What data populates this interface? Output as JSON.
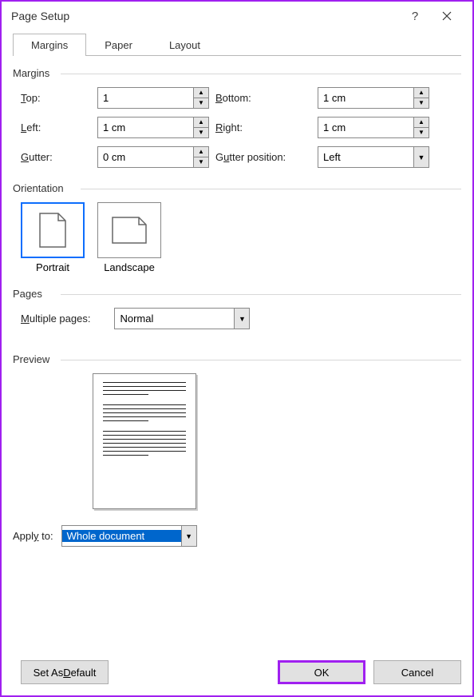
{
  "title": "Page Setup",
  "tabs": {
    "margins": "Margins",
    "paper": "Paper",
    "layout": "Layout"
  },
  "groups": {
    "margins": "Margins",
    "orientation": "Orientation",
    "pages": "Pages",
    "preview": "Preview"
  },
  "margin_fields": {
    "top_label": "Top:",
    "top_value": "1",
    "bottom_label": "Bottom:",
    "bottom_value": "1 cm",
    "left_label": "Left:",
    "left_value": "1 cm",
    "right_label": "Right:",
    "right_value": "1 cm",
    "gutter_label": "Gutter:",
    "gutter_value": "0 cm",
    "gutter_pos_label": "Gutter position:",
    "gutter_pos_value": "Left"
  },
  "orientation": {
    "portrait": "Portrait",
    "landscape": "Landscape"
  },
  "pages_field": {
    "label": "Multiple pages:",
    "value": "Normal"
  },
  "apply": {
    "label": "Apply to:",
    "value": "Whole document"
  },
  "buttons": {
    "default": "Set As Default",
    "ok": "OK",
    "cancel": "Cancel"
  }
}
